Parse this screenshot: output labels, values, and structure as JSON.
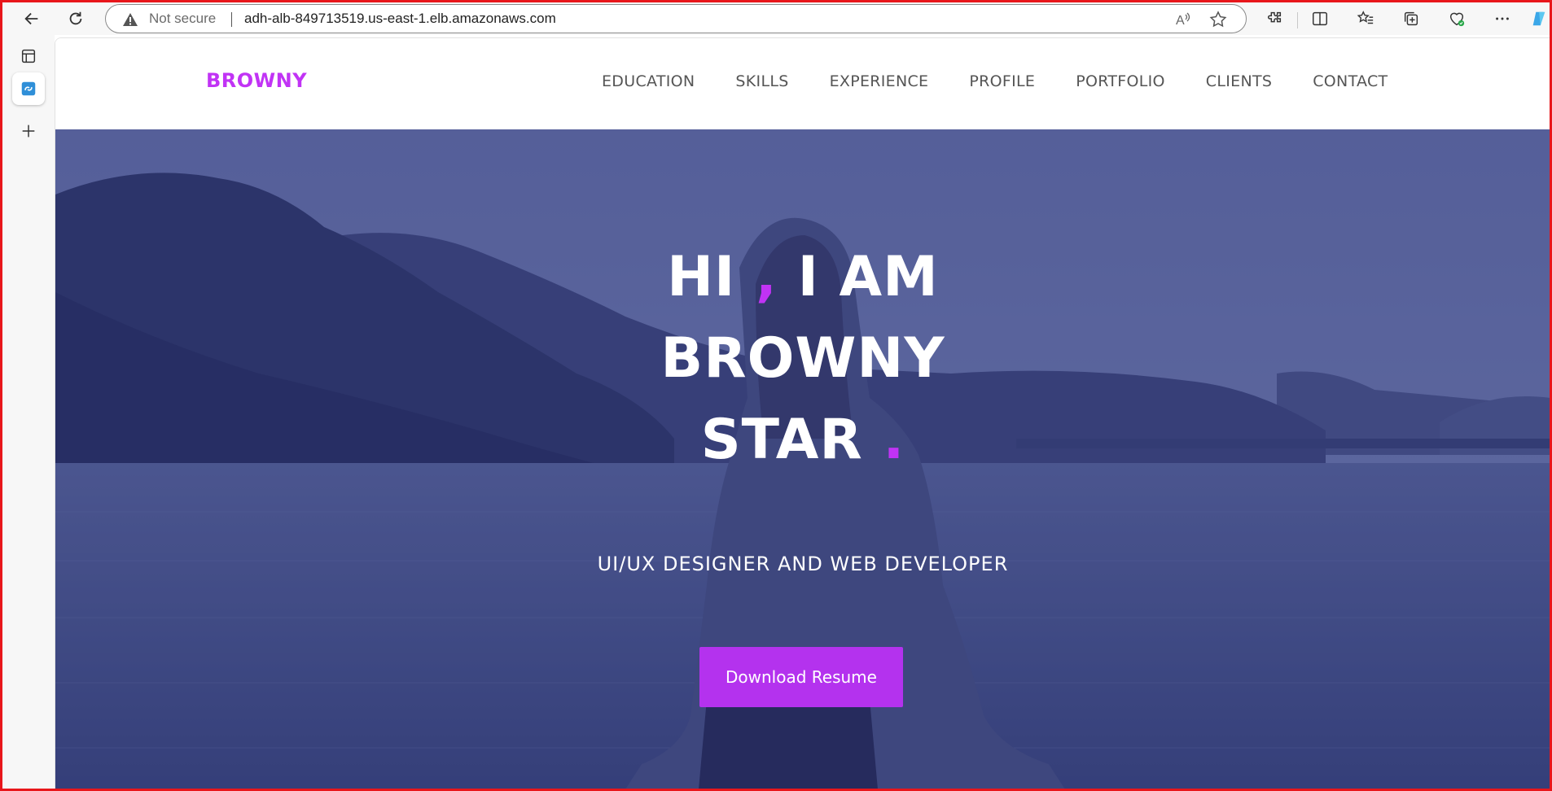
{
  "browser": {
    "security_label": "Not secure",
    "url": "adh-alb-849713519.us-east-1.elb.amazonaws.com"
  },
  "site": {
    "brand": "BROWNY",
    "nav": [
      "EDUCATION",
      "SKILLS",
      "EXPERIENCE",
      "PROFILE",
      "PORTFOLIO",
      "CLIENTS",
      "CONTACT"
    ],
    "hero": {
      "line1_a": "HI",
      "line1_comma": ",",
      "line1_b": "I AM",
      "line2": "BROWNY",
      "line3": "STAR",
      "line3_dot": ".",
      "subtitle": "UI/UX DESIGNER AND WEB DEVELOPER",
      "cta": "Download Resume"
    }
  },
  "colors": {
    "accent": "#c133f5",
    "button": "#b432ee",
    "frame": "#e8161b"
  }
}
